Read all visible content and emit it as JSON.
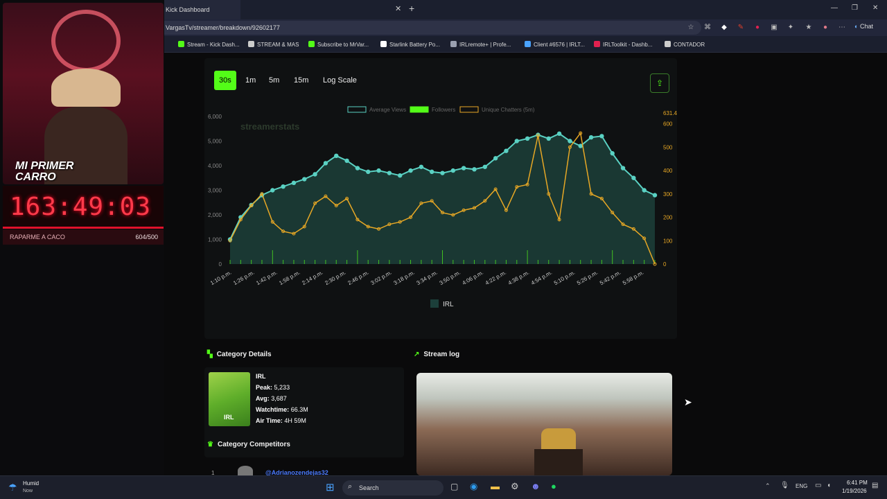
{
  "browser": {
    "tab_title": "Kick Dashboard",
    "url": "VargasTv/streamer/breakdown/92602177",
    "chat_label": "Chat",
    "bookmarks": [
      {
        "label": "Stream - Kick Dash...",
        "color": "#53fc18"
      },
      {
        "label": "STREAM & MAS",
        "color": "#cccccc"
      },
      {
        "label": "Subscribe to MrVar...",
        "color": "#53fc18"
      },
      {
        "label": "Starlink Battery Po...",
        "color": "#ffffff"
      },
      {
        "label": "IRLremote+ | Profe...",
        "color": "#9aa0b0"
      },
      {
        "label": "Client #6576 | IRLT...",
        "color": "#4aa3ff"
      },
      {
        "label": "IRLToolkit - Dashb...",
        "color": "#e0214f"
      },
      {
        "label": "CONTADOR",
        "color": "#cccccc"
      }
    ]
  },
  "overlay": {
    "cam_text": "MI PRIMER CARRO",
    "timer": "163:49:03",
    "goal_label": "RAPARME A CACO",
    "goal_count": "604/500"
  },
  "chart_controls": {
    "intervals": [
      "30s",
      "1m",
      "5m",
      "15m"
    ],
    "active": "30s",
    "log_scale": "Log Scale"
  },
  "chart_data": {
    "type": "line",
    "watermark": "streamerstats",
    "legend": [
      "Average Views",
      "Followers",
      "Unique Chatters (5m)"
    ],
    "bottom_legend": "IRL",
    "colors": {
      "views": "#5ad1c3",
      "chatters": "#e8a825",
      "followers": "#53fc18"
    },
    "x_ticks": [
      "1:10 p.m.",
      "1:26 p.m.",
      "1:42 p.m.",
      "1:58 p.m.",
      "2:14 p.m.",
      "2:30 p.m.",
      "2:46 p.m.",
      "3:02 p.m.",
      "3:18 p.m.",
      "3:34 p.m.",
      "3:50 p.m.",
      "4:06 p.m.",
      "4:22 p.m.",
      "4:38 p.m.",
      "4:54 p.m.",
      "5:10 p.m.",
      "5:26 p.m.",
      "5:42 p.m.",
      "5:58 p.m."
    ],
    "y_left_ticks": [
      "6,000",
      "5,000",
      "4,000",
      "3,000",
      "2,000",
      "1,000",
      "0"
    ],
    "y_right_ticks": [
      "631.4",
      "600",
      "500",
      "400",
      "300",
      "200",
      "100",
      "0"
    ],
    "ylim_left": [
      0,
      6000
    ],
    "ylim_right": [
      0,
      631.4
    ],
    "series": [
      {
        "name": "Average Views",
        "axis": "left",
        "values": [
          1000,
          1900,
          2400,
          2800,
          3000,
          3150,
          3300,
          3450,
          3650,
          4100,
          4400,
          4200,
          3900,
          3750,
          3800,
          3700,
          3600,
          3800,
          3950,
          3750,
          3700,
          3800,
          3900,
          3850,
          3950,
          4300,
          4600,
          5000,
          5100,
          5250,
          5100,
          5300,
          5000,
          4800,
          5150,
          5200,
          4500,
          3900,
          3500,
          3000,
          2800
        ],
        "y_text_hint": ""
      },
      {
        "name": "Unique Chatters (5m)",
        "axis": "right",
        "values": [
          100,
          190,
          250,
          300,
          180,
          140,
          130,
          160,
          260,
          290,
          250,
          280,
          190,
          160,
          150,
          170,
          180,
          200,
          260,
          270,
          220,
          210,
          230,
          240,
          270,
          320,
          230,
          330,
          340,
          550,
          300,
          190,
          500,
          560,
          300,
          280,
          220,
          170,
          150,
          110,
          0
        ]
      }
    ]
  },
  "category": {
    "section_title": "Category Details",
    "name": "IRL",
    "thumb_label": "IRL",
    "peak_label": "Peak:",
    "peak": "5,233",
    "avg_label": "Avg:",
    "avg": "3,687",
    "watch_label": "Watchtime:",
    "watch": "66.3M",
    "air_label": "Air Time:",
    "air": "4H 59M"
  },
  "competitors": {
    "section_title": "Category Competitors",
    "first_rank": "1",
    "first_name": "@Adrianozendejas32"
  },
  "stream_log": {
    "section_title": "Stream log"
  },
  "taskbar": {
    "weather_title": "Humid",
    "weather_sub": "Now",
    "search": "Search",
    "lang": "ENG",
    "time": "6:41 PM",
    "date": "1/19/2026"
  }
}
